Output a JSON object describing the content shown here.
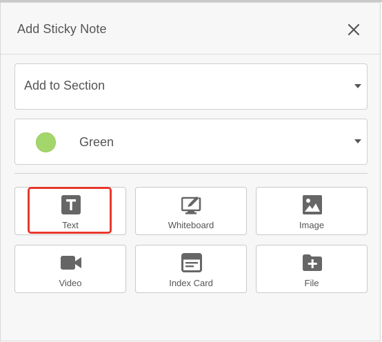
{
  "dialog": {
    "title": "Add Sticky Note",
    "close_icon": "close-icon"
  },
  "section_select": {
    "value": "Add to Section",
    "icon": "chevron-down-icon"
  },
  "color_select": {
    "value": "Green",
    "swatch_color": "#a4d76b",
    "icon": "chevron-down-icon"
  },
  "note_types": [
    {
      "label": "Text",
      "icon": "text-icon"
    },
    {
      "label": "Whiteboard",
      "icon": "whiteboard-icon"
    },
    {
      "label": "Image",
      "icon": "image-icon"
    },
    {
      "label": "Video",
      "icon": "video-icon"
    },
    {
      "label": "Index Card",
      "icon": "index-card-icon"
    },
    {
      "label": "File",
      "icon": "add-file-icon"
    }
  ],
  "highlight": {
    "target": "Text",
    "color": "#e8372b"
  }
}
